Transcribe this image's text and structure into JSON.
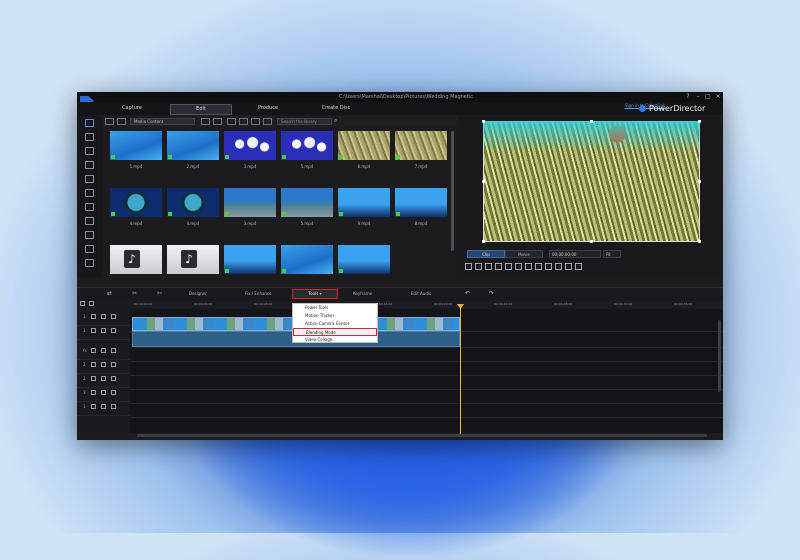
{
  "window": {
    "title": "C:\\Users\\Marshal\\Desktop\\Pictures\\Wedding Magnetic",
    "signin_label": "Sign in to CyberLink",
    "brand": "PowerDirector"
  },
  "main_tabs": [
    {
      "label": "Capture"
    },
    {
      "label": "Edit",
      "active": true
    },
    {
      "label": "Produce"
    },
    {
      "label": "Create Disc"
    }
  ],
  "library": {
    "filter_label": "Media Content",
    "search_placeholder": "Search the library",
    "items": [
      {
        "caption": "1.mp4",
        "kind": "water"
      },
      {
        "caption": "2.mp4",
        "kind": "water"
      },
      {
        "caption": "3.mp4",
        "kind": "bubble"
      },
      {
        "caption": "5.mp4",
        "kind": "bubble"
      },
      {
        "caption": "6.mp4",
        "kind": "anem"
      },
      {
        "caption": "7.mp4",
        "kind": "anem"
      },
      {
        "caption": "4.mp4",
        "kind": "port"
      },
      {
        "caption": "4.mp4",
        "kind": "port"
      },
      {
        "caption": "3.mp4",
        "kind": "reef"
      },
      {
        "caption": "5.mp4",
        "kind": "reef"
      },
      {
        "caption": "9.mp4",
        "kind": "deep"
      },
      {
        "caption": "8.mp4",
        "kind": "deep"
      },
      {
        "caption": "",
        "kind": "audio"
      },
      {
        "caption": "",
        "kind": "audio"
      },
      {
        "caption": "",
        "kind": "deep"
      },
      {
        "caption": "",
        "kind": "water"
      },
      {
        "caption": "",
        "kind": "deep"
      }
    ]
  },
  "preview": {
    "clip_label": "Clip",
    "movie_label": "Movie",
    "timecode_1": "00;00;00;00",
    "timecode_2": "Fit"
  },
  "edit_toolbar": {
    "designer_label": "Designer",
    "fix_enhance_label": "Fix / Enhance",
    "tools_label": "Tools",
    "keyframe_label": "Keyframe",
    "edit_audio_label": "Edit Audio"
  },
  "tools_menu": {
    "items": [
      {
        "label": "Power Tools"
      },
      {
        "label": "Motion Tracker"
      },
      {
        "label": "Action Camera Center"
      },
      {
        "label": "Blending Mode",
        "highlighted": true
      },
      {
        "label": "Video Collage"
      }
    ]
  },
  "ruler": {
    "ticks": [
      "00;00;00;00",
      "00;00;04;00",
      "00;00;08;00",
      "00;00;12;00",
      "00;00;16;00",
      "00;00;20;00",
      "00;00;24;00",
      "00;00;28;00",
      "00;00;32;00",
      "00;00;36;00"
    ]
  },
  "tracks": [
    {
      "num": "1"
    },
    {
      "num": "1"
    },
    {
      "num": "fx"
    },
    {
      "num": "2"
    },
    {
      "num": "2"
    },
    {
      "num": "3"
    },
    {
      "num": "3"
    }
  ]
}
